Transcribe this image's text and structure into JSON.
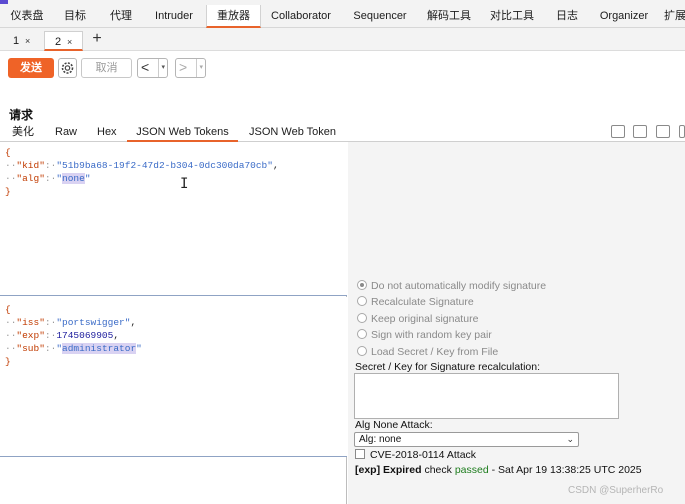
{
  "main_tabs": [
    "仪表盘",
    "目标",
    "代理",
    "Intruder",
    "重放器",
    "Collaborator",
    "Sequencer",
    "解码工具",
    "对比工具",
    "日志",
    "Organizer",
    "扩展"
  ],
  "active_main_tab": "重放器",
  "request_tabs": [
    {
      "label": "1",
      "close": "×"
    },
    {
      "label": "2",
      "close": "×"
    }
  ],
  "new_tab": "+",
  "toolbar": {
    "send_label": "发送",
    "cancel_label": "取消",
    "back_arrow": "<",
    "forward_arrow": ">",
    "dropdown": "▾"
  },
  "request_title": "请求",
  "view_tabs": [
    "美化",
    "Raw",
    "Hex",
    "JSON Web Tokens",
    "JSON Web Token"
  ],
  "active_view_tab": "JSON Web Tokens",
  "view_icons": [
    "hide-icon",
    "wrap-icon",
    "newline-icon",
    "menu-icon"
  ],
  "jwt_header": {
    "open": "{",
    "kid_key": "\"kid\"",
    "kid_value": "\"51b9ba68-19f2-47d2-b304-0dc300da70cb\"",
    "alg_key": "\"alg\"",
    "alg_value_quote": "\"",
    "alg_value": "none",
    "close": "}"
  },
  "jwt_payload": {
    "open": "{",
    "iss_key": "\"iss\"",
    "iss_value": "\"portswigger\"",
    "exp_key": "\"exp\"",
    "exp_value": "1745069905",
    "sub_key": "\"sub\"",
    "sub_value": "administrator",
    "close": "}"
  },
  "cursor_glyph": "I",
  "signature_options": [
    {
      "label": "Do not automatically modify signature",
      "selected": true
    },
    {
      "label": "Recalculate Signature",
      "selected": false
    },
    {
      "label": "Keep original signature",
      "selected": false
    },
    {
      "label": "Sign with random key pair",
      "selected": false
    },
    {
      "label": "Load Secret / Key from File",
      "selected": false
    }
  ],
  "secret_label": "Secret / Key for Signature recalculation:",
  "secret_value": "",
  "alg_none_label": "Alg None Attack:",
  "alg_none_selected": "Alg: none",
  "cve_label": "CVE-2018-0114 Attack",
  "cve_checked": false,
  "status": {
    "prefix": "[exp] Expired",
    "middle": "check",
    "passed": "passed",
    "suffix": "- Sat Apr 19 13:38:25 UTC 2025"
  },
  "watermark": "CSDN @SuperherRo",
  "colors": {
    "accent": "#e8632b",
    "send_button": "#ef6327",
    "passed": "#1e7d1e",
    "json_key": "#c13b00",
    "json_string": "#3a6bc7",
    "highlight": "#d9d2f2"
  }
}
